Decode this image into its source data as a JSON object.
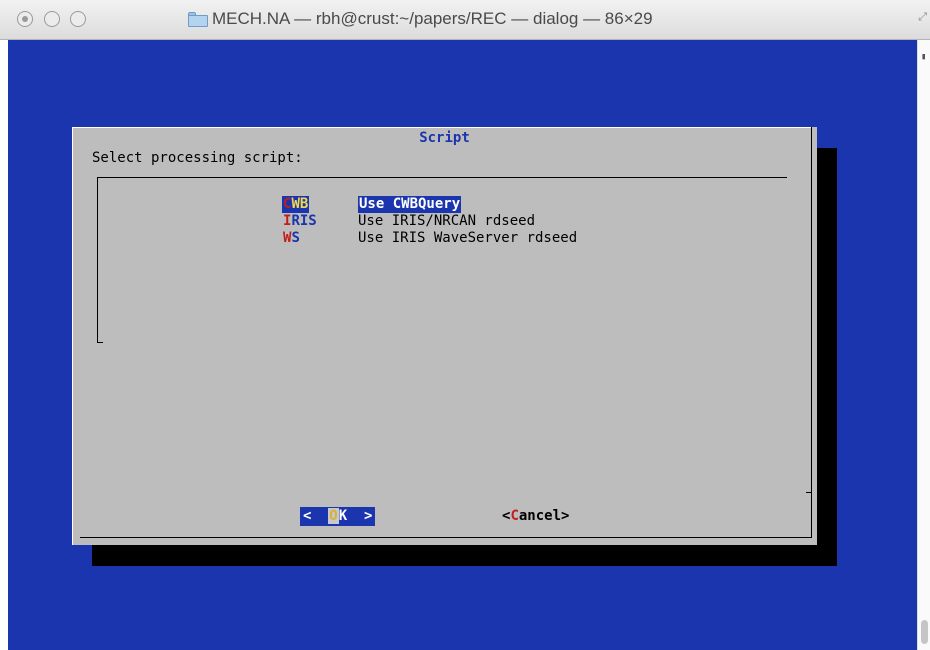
{
  "window": {
    "title": "MECH.NA — rbh@crust:~/papers/REC — dialog — 86×29"
  },
  "dialog": {
    "title": "Script",
    "prompt": "Select processing script:",
    "items": [
      {
        "tag_first": "C",
        "tag_rest": "WB",
        "description": "Use CWBQuery",
        "selected": true
      },
      {
        "tag_first": "I",
        "tag_rest": "RIS",
        "description": "Use IRIS/NRCAN rdseed",
        "selected": false
      },
      {
        "tag_first": "W",
        "tag_rest": "S",
        "description": "Use IRIS WaveServer rdseed",
        "selected": false
      }
    ],
    "ok_button": {
      "left": "<  ",
      "hot": "O",
      "rest": "K",
      "right": "  >"
    },
    "cancel_button": {
      "left": "<",
      "hot": "C",
      "rest": "ancel",
      "right": ">"
    }
  },
  "colors": {
    "terminal_background": "#1a35ad",
    "dialog_background": "#bdbdbd",
    "hotkey_red": "#c0201c",
    "highlight_yellow": "#f2d84b"
  },
  "icons": [
    "window-close-icon",
    "window-minimize-icon",
    "window-zoom-icon",
    "folder-icon",
    "fullscreen-icon"
  ]
}
